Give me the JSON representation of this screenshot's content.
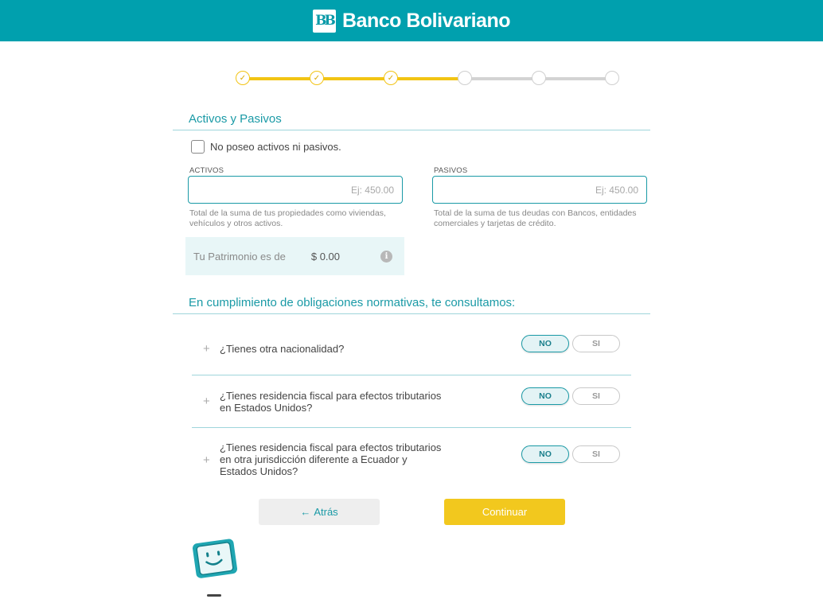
{
  "header": {
    "brand_mark": "BB",
    "brand_name": "Banco Bolivariano"
  },
  "stepper": {
    "total_steps": 6,
    "completed_steps": 3
  },
  "assets_section": {
    "title": "Activos y Pasivos",
    "no_assets_checkbox_label": "No poseo activos ni pasivos.",
    "no_assets_checked": false,
    "activos": {
      "label": "ACTIVOS",
      "value": "",
      "placeholder": "Ej: 450.00",
      "help": "Total de la suma de tus propiedades como viviendas, vehículos y otros activos."
    },
    "pasivos": {
      "label": "PASIVOS",
      "value": "",
      "placeholder": "Ej: 450.00",
      "help": "Total de la suma de tus deudas con Bancos, entidades comerciales y tarjetas de crédito."
    },
    "patrimonio": {
      "label": "Tu Patrimonio es de",
      "value": "$ 0.00",
      "info_icon": "i"
    }
  },
  "compliance_section": {
    "title": "En cumplimiento de obligaciones normativas, te consultamos:",
    "questions": [
      {
        "text": "¿Tienes otra nacionalidad?",
        "no_label": "NO",
        "yes_label": "SI",
        "selected": "NO"
      },
      {
        "text": "¿Tienes residencia fiscal para efectos tributarios en Estados Unidos?",
        "no_label": "NO",
        "yes_label": "SI",
        "selected": "NO"
      },
      {
        "text": "¿Tienes residencia fiscal para efectos tributarios en otra jurisdicción diferente a Ecuador y Estados Unidos?",
        "no_label": "NO",
        "yes_label": "SI",
        "selected": "NO"
      }
    ]
  },
  "actions": {
    "back_label": "Atrás",
    "back_icon": "←",
    "continue_label": "Continuar"
  },
  "colors": {
    "header": "#00a0ae",
    "accent": "#1a9aa6",
    "progress": "#f2c414",
    "continue_button": "#f2c81e"
  },
  "icons": {
    "step_done": "✓",
    "expand": "+"
  }
}
